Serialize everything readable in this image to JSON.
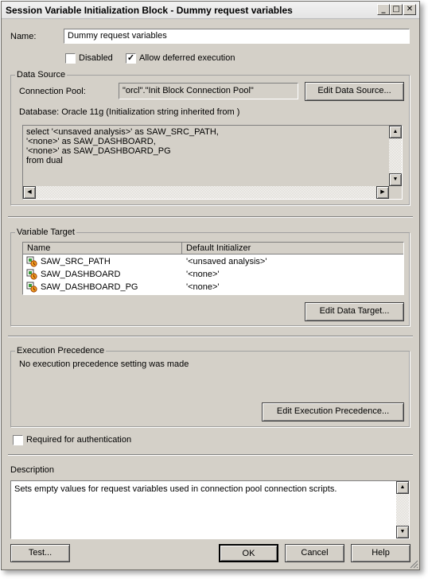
{
  "window": {
    "title": "Session Variable Initialization Block - Dummy request variables",
    "minimize_glyph": "_",
    "maximize_glyph": "□",
    "close_glyph": "✕"
  },
  "name": {
    "label": "Name:",
    "value": "Dummy request variables"
  },
  "options": {
    "disabled_label": "Disabled",
    "disabled_checked": false,
    "deferred_label": "Allow deferred execution",
    "deferred_checked": true
  },
  "data_source": {
    "group_title": "Data Source",
    "connection_pool_label": "Connection Pool:",
    "connection_pool_value": "\"orcl\".\"Init Block Connection Pool\"",
    "edit_button": "Edit Data Source...",
    "database_line": "Database: Oracle 11g (Initialization string inherited from )",
    "sql_lines": [
      "select '<unsaved analysis>' as SAW_SRC_PATH,",
      "'<none>' as SAW_DASHBOARD,",
      "'<none>' as SAW_DASHBOARD_PG",
      "from dual"
    ]
  },
  "variable_target": {
    "group_title": "Variable Target",
    "columns": [
      "Name",
      "Default Initializer"
    ],
    "rows": [
      {
        "name": "SAW_SRC_PATH",
        "initializer": "'<unsaved analysis>'"
      },
      {
        "name": "SAW_DASHBOARD",
        "initializer": "'<none>'"
      },
      {
        "name": "SAW_DASHBOARD_PG",
        "initializer": "'<none>'"
      }
    ],
    "edit_button": "Edit Data Target..."
  },
  "execution_precedence": {
    "group_title": "Execution Precedence",
    "message": "No execution precedence setting was made",
    "edit_button": "Edit Execution Precedence..."
  },
  "auth": {
    "label": "Required for authentication",
    "checked": false
  },
  "description": {
    "label": "Description",
    "text": "Sets empty values for request variables used in connection pool connection scripts."
  },
  "footer": {
    "test_button": "Test...",
    "ok_button": "OK",
    "cancel_button": "Cancel",
    "help_button": "Help"
  },
  "scroll_glyphs": {
    "up": "▲",
    "down": "▼",
    "left": "◀",
    "right": "▶"
  },
  "colors": {
    "dialog_bg": "#d4d0c8",
    "field_bg": "#ffffff"
  }
}
